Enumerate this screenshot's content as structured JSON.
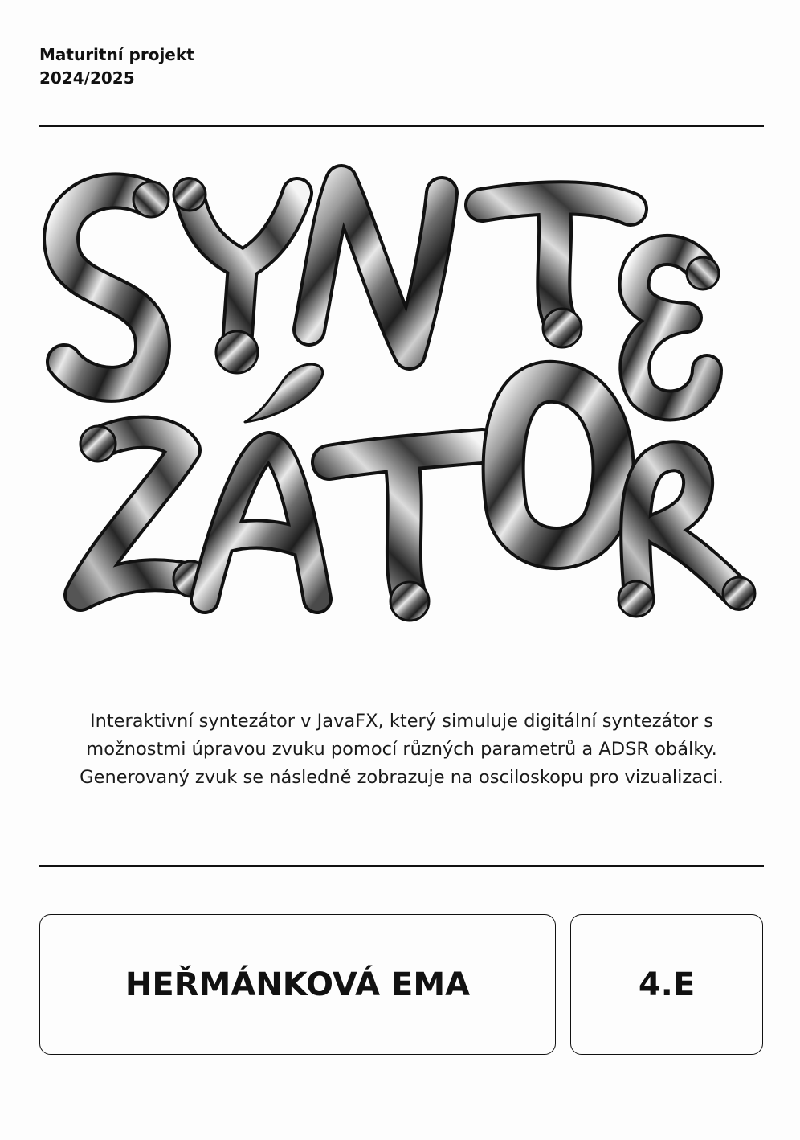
{
  "header": {
    "line1": "Maturitní projekt",
    "line2": "2024/2025"
  },
  "title_art": {
    "row1": [
      "S",
      "Y",
      "N",
      "T",
      "E"
    ],
    "row2": [
      "Z",
      "Á",
      "T",
      "O",
      "R"
    ],
    "style": "chrome liquid 3D lettering"
  },
  "description": {
    "line1": "Interaktivní syntezátor v JavaFX, který simuluje digitální syntezátor s",
    "line2": "možnostmi úpravou zvuku pomocí různých parametrů a ADSR obálky.",
    "line3": "Generovaný zvuk se následně zobrazuje na osciloskopu pro vizualizaci."
  },
  "author": {
    "name": "HEŘMÁNKOVÁ EMA",
    "class": "4.E"
  },
  "colors": {
    "background": "#fdfdfd",
    "ink": "#111111",
    "chrome_light": "#f4f4f4",
    "chrome_dark": "#2a2a2a"
  }
}
